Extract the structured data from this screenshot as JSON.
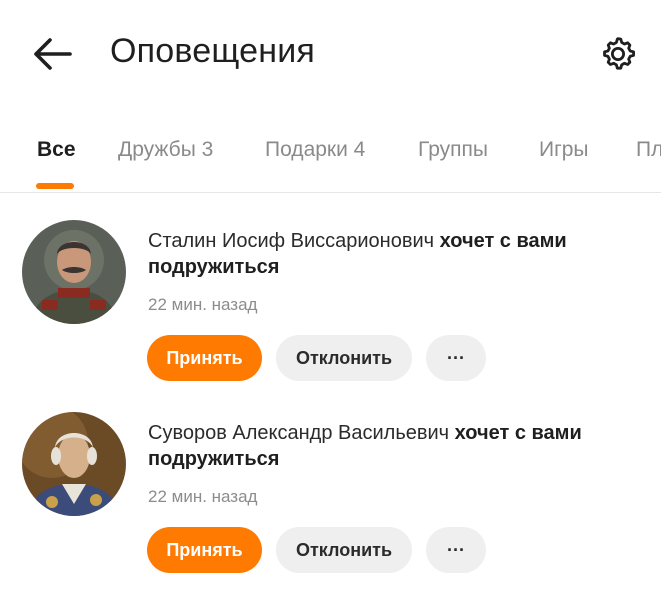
{
  "header": {
    "title": "Оповещения",
    "back_icon": "arrow-left-icon",
    "settings_icon": "gear-icon"
  },
  "tabs": [
    {
      "label": "Все",
      "active": true
    },
    {
      "label": "Дружбы 3",
      "active": false
    },
    {
      "label": "Подарки 4",
      "active": false
    },
    {
      "label": "Группы",
      "active": false
    },
    {
      "label": "Игры",
      "active": false
    },
    {
      "label": "Пл",
      "active": false
    }
  ],
  "colors": {
    "accent": "#ff7a00",
    "secondary_button": "#efefef",
    "muted_text": "#8c8c8c"
  },
  "notifications": [
    {
      "name": "Сталин Иосиф Виссарионович",
      "action": "хочет с вами подружиться",
      "time": "22 мин. назад",
      "accept_label": "Принять",
      "decline_label": "Отклонить",
      "more_label": "···"
    },
    {
      "name": "Суворов Александр Васильевич",
      "action": "хочет с вами подружиться",
      "time": "22 мин. назад",
      "accept_label": "Принять",
      "decline_label": "Отклонить",
      "more_label": "···"
    }
  ]
}
